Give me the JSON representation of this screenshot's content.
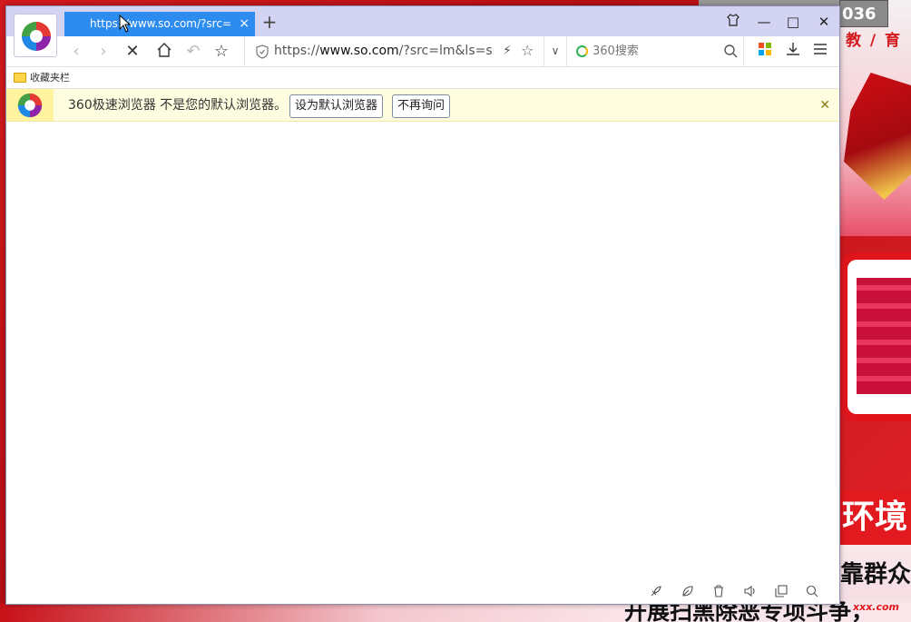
{
  "desktop": {
    "corner_number": "036",
    "red_text": "教 / 育",
    "bottom_text_1": "靠群众",
    "bottom_text_2": "开展扫黑除恶专项斗争，",
    "red_bar_text": "环境",
    "site_mark": "xxx.com"
  },
  "tab": {
    "title": "https://www.so.com/?src=lm&ls=sm",
    "close": "×"
  },
  "new_tab_label": "+",
  "window_controls": {
    "shirt": "skin-icon",
    "minimize": "—",
    "maximize": "□",
    "close": "✕"
  },
  "toolbar": {
    "back": "‹",
    "forward": "›",
    "stop": "✕",
    "home": "home-icon",
    "undo": "↶",
    "favorite": "☆"
  },
  "address": {
    "prefix": "https://",
    "host": "www.so.com",
    "rest": "/?src=lm&ls=sm",
    "bolt": "⚡",
    "star": "☆",
    "dropdown": "∨"
  },
  "search": {
    "placeholder": "360搜索"
  },
  "bookmarks": {
    "folder_label": "收藏夹栏"
  },
  "notice": {
    "message": "360极速浏览器 不是您的默认浏览器。",
    "set_default": "设为默认浏览器",
    "dont_ask": "不再询问",
    "close": "✕"
  },
  "statusbar_icons": [
    "rocket-icon",
    "leaf-icon",
    "trash-icon",
    "speaker-icon",
    "window-icon",
    "search-icon"
  ],
  "colors": {
    "tab_blue": "#2d8cf0",
    "titlebar": "#d3d4f4",
    "notice_bg": "#fffde0"
  }
}
